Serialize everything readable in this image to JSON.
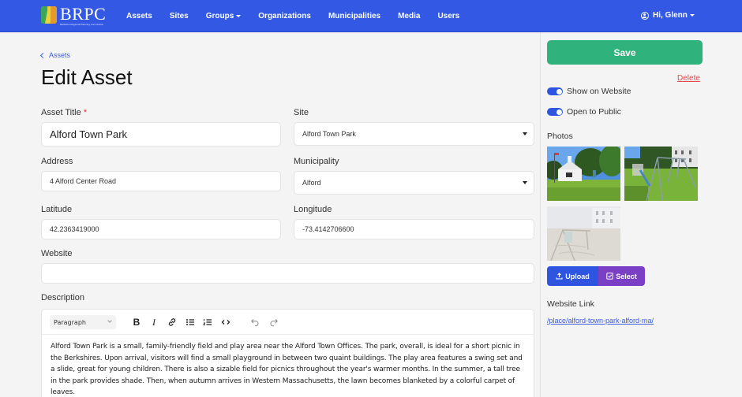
{
  "navbar": {
    "logo": {
      "brand": "BRPC",
      "subtitle": "Berkshire Regional Planning Commission"
    },
    "links": [
      {
        "label": "Assets",
        "dropdown": false
      },
      {
        "label": "Sites",
        "dropdown": false
      },
      {
        "label": "Groups",
        "dropdown": true
      },
      {
        "label": "Organizations",
        "dropdown": false
      },
      {
        "label": "Municipalities",
        "dropdown": false
      },
      {
        "label": "Media",
        "dropdown": false
      },
      {
        "label": "Users",
        "dropdown": false
      }
    ],
    "user": {
      "greeting": "Hi, Glenn",
      "icon": "user-circle-icon"
    }
  },
  "breadcrumb": {
    "back_label": "Assets"
  },
  "page_title": "Edit Asset",
  "form": {
    "asset_title": {
      "label": "Asset Title",
      "required_marker": "*",
      "value": "Alford Town Park"
    },
    "site": {
      "label": "Site",
      "value": "Alford Town Park"
    },
    "address": {
      "label": "Address",
      "value": "4 Alford Center Road"
    },
    "municipality": {
      "label": "Municipality",
      "value": "Alford"
    },
    "latitude": {
      "label": "Latitude",
      "value": "42.2363419000"
    },
    "longitude": {
      "label": "Longitude",
      "value": "-73.4142706600"
    },
    "website": {
      "label": "Website",
      "value": ""
    },
    "description": {
      "label": "Description",
      "toolbar": {
        "block_type": "Paragraph",
        "buttons": [
          "bold-icon",
          "italic-icon",
          "link-icon",
          "bullet-list-icon",
          "numbered-list-icon",
          "code-icon",
          "undo-icon",
          "redo-icon"
        ]
      },
      "content": "Alford Town Park is a small, family-friendly field and play area near the Alford Town Offices. The park, overall, is ideal for a short picnic in the Berkshires. Upon arrival, visitors will find a small playground in between two quaint buildings. The play area features a swing set and a slide, great for young children. There is also a sizable field for picnics throughout the year's warmer months. In the summer, a tall tree in the park provides shade. Then, when autumn arrives in Western Massachusetts, the lawn becomes blanketed by a colorful carpet of leaves."
    }
  },
  "sidebar": {
    "save_label": "Save",
    "delete_label": "Delete",
    "toggles": [
      {
        "label": "Show on Website",
        "on": true
      },
      {
        "label": "Open to Public",
        "on": true
      }
    ],
    "photos_label": "Photos",
    "photos": [
      {
        "alt": "White town hall building with flag on green lawn"
      },
      {
        "alt": "Swing set and slide on grassy lawn beside white building"
      },
      {
        "alt": "Faded playground photo in early spring"
      }
    ],
    "upload_label": "Upload",
    "select_label": "Select",
    "website_link_label": "Website Link",
    "website_link": "/place/alford-town-park-alford-ma/"
  },
  "colors": {
    "navbar": "#3358e4",
    "save": "#2fb27b",
    "delete": "#e5484d",
    "upload": "#2f55e0",
    "select": "#7b3fc6",
    "link": "#3b5bdb"
  }
}
